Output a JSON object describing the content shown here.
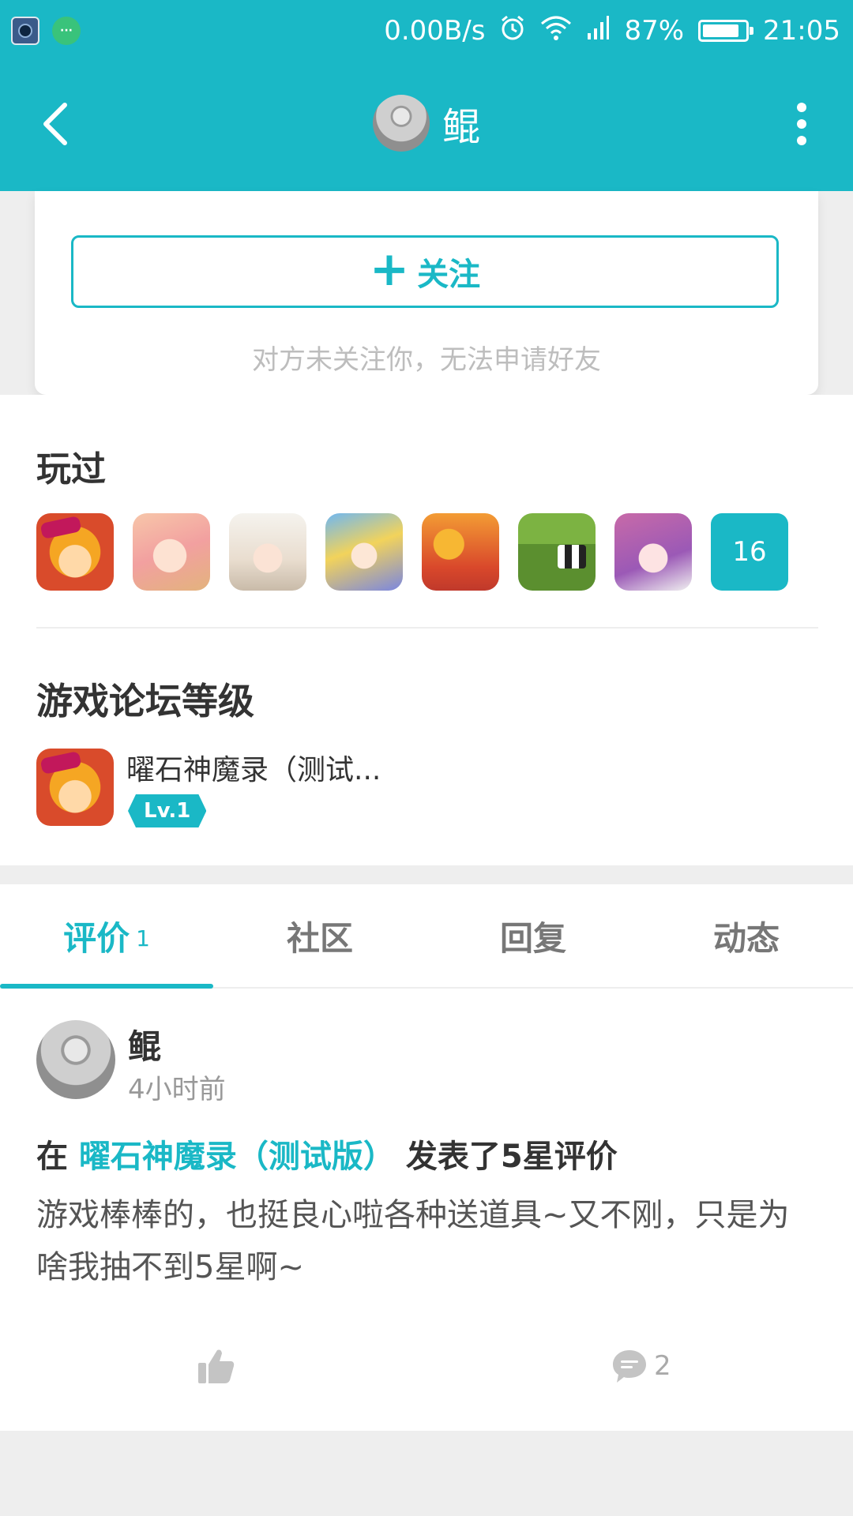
{
  "status_bar": {
    "network_speed": "0.00B/s",
    "battery_percent": "87%",
    "battery_level": 0.87,
    "time": "21:05",
    "icons": [
      "alarm-icon",
      "wifi-icon",
      "signal-icon",
      "battery-icon"
    ]
  },
  "header": {
    "title": "鲲",
    "icons": {
      "back": "chevron-left-icon",
      "more": "more-vertical-icon"
    }
  },
  "follow": {
    "button_label": "关注",
    "plus": "+",
    "hint": "对方未关注你，无法申请好友"
  },
  "played": {
    "title": "玩过",
    "games": [
      "game-icon-1",
      "game-icon-2",
      "game-icon-3",
      "game-icon-4",
      "game-icon-5",
      "game-icon-6",
      "game-icon-7"
    ],
    "more_count": "16"
  },
  "forum_level": {
    "title": "游戏论坛等级",
    "game_name": "曜石神魔录（测试...",
    "level": "Lv.1"
  },
  "tabs": [
    {
      "label": "评价",
      "count": "1",
      "active": true
    },
    {
      "label": "社区"
    },
    {
      "label": "回复"
    },
    {
      "label": "动态"
    }
  ],
  "post": {
    "author": "鲲",
    "time": "4小时前",
    "prefix": "在 ",
    "game_link": "曜石神魔录（测试版）",
    "suffix": " 发表了5星评价",
    "body": "游戏棒棒的，也挺良心啦各种送道具~又不刚，只是为啥我抽不到5星啊~",
    "comment_count": "2"
  },
  "colors": {
    "accent": "#1ab8c6",
    "background": "#eeeeee",
    "text": "#333333",
    "muted": "#bdbdbd"
  }
}
